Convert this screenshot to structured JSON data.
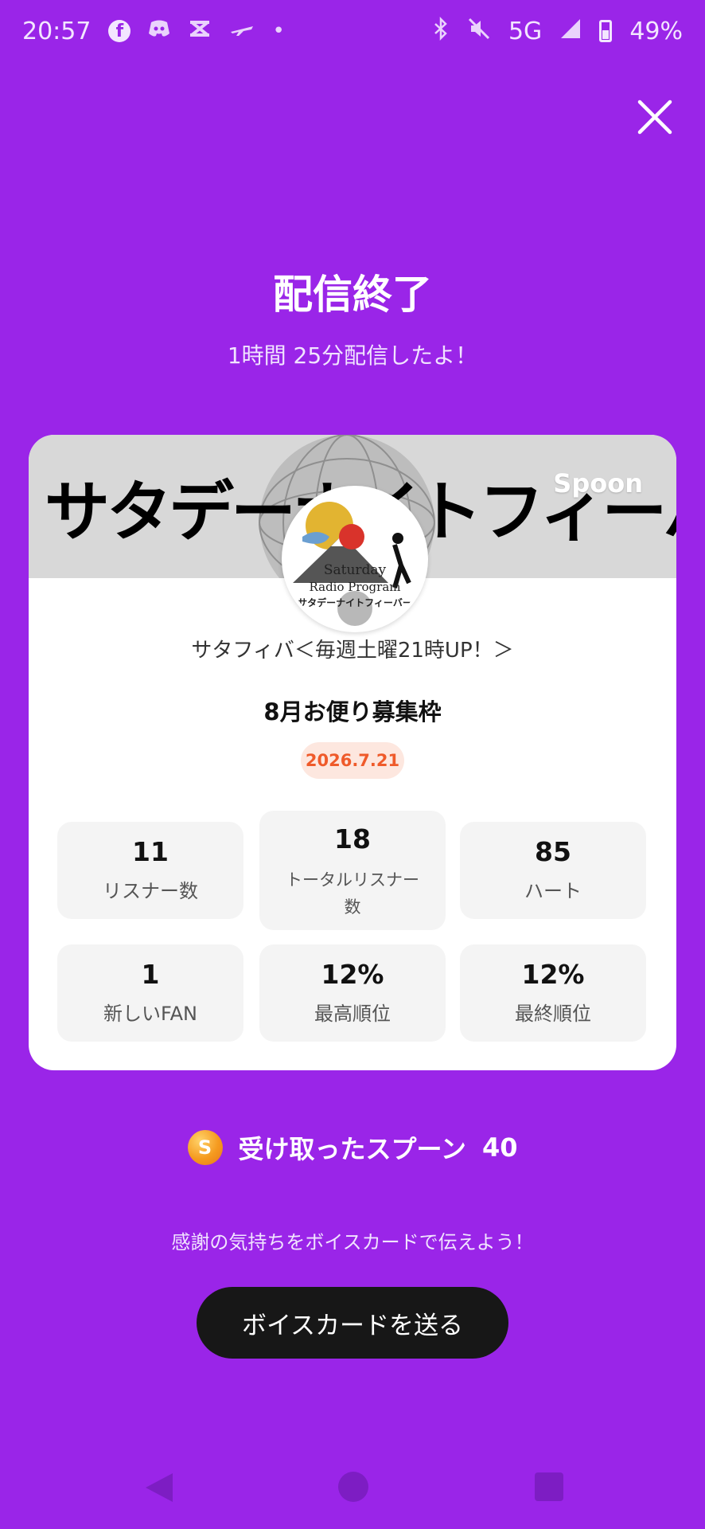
{
  "status_bar": {
    "time": "20:57",
    "network": "5G",
    "battery": "49%"
  },
  "header": {
    "title": "配信終了",
    "subtitle": "1時間 25分配信したよ！"
  },
  "card": {
    "banner_text": "サタデーナイトフィーバーズ",
    "banner_logo": "Spoon",
    "avatar_lines": [
      "Saturday",
      "Radio Program",
      "サタデーナイトフィーバー"
    ],
    "channel_name": "サタフィバ＜毎週土曜21時UP！＞",
    "stream_title": "8月お便り募集枠",
    "date": "2026.7.21",
    "stats": [
      {
        "value": "11",
        "label": "リスナー数"
      },
      {
        "value": "18",
        "label": "トータルリスナー数"
      },
      {
        "value": "85",
        "label": "ハート"
      },
      {
        "value": "1",
        "label": "新しいFAN"
      },
      {
        "value": "12%",
        "label": "最高順位"
      },
      {
        "value": "12%",
        "label": "最終順位"
      }
    ]
  },
  "spoon": {
    "icon_letter": "S",
    "label": "受け取ったスプーン",
    "count": "40"
  },
  "thanks_text": "感謝の気持ちをボイスカードで伝えよう！",
  "voice_button": "ボイスカードを送る",
  "colors": {
    "background": "#9a25e8",
    "button": "#171717",
    "date_text": "#ef5a2a",
    "date_bg": "#fde7df"
  }
}
